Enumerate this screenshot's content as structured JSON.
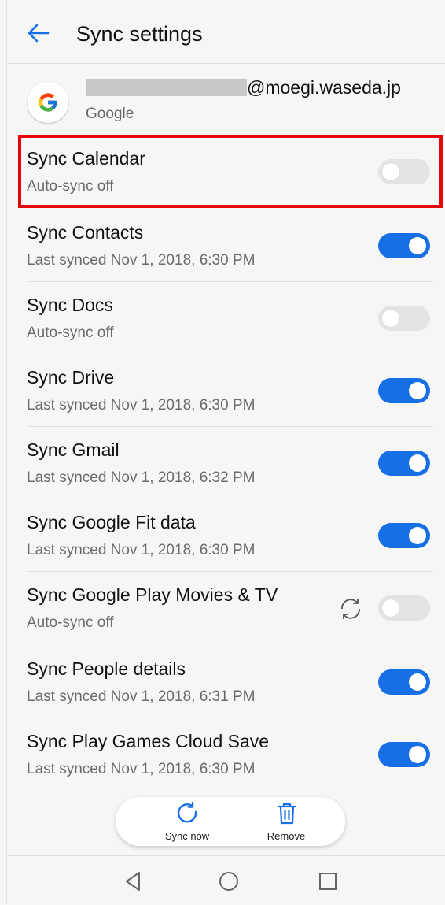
{
  "header": {
    "title": "Sync settings"
  },
  "account": {
    "email_suffix": "@moegi.waseda.jp",
    "type": "Google"
  },
  "items": [
    {
      "label": "Sync Calendar",
      "status": "Auto-sync off",
      "on": false
    },
    {
      "label": "Sync Contacts",
      "status": "Last synced Nov 1, 2018, 6:30 PM",
      "on": true
    },
    {
      "label": "Sync Docs",
      "status": "Auto-sync off",
      "on": false
    },
    {
      "label": "Sync Drive",
      "status": "Last synced Nov 1, 2018, 6:30 PM",
      "on": true
    },
    {
      "label": "Sync Gmail",
      "status": "Last synced Nov 1, 2018, 6:32 PM",
      "on": true
    },
    {
      "label": "Sync Google Fit data",
      "status": "Last synced Nov 1, 2018, 6:30 PM",
      "on": true
    },
    {
      "label": "Sync Google Play Movies & TV",
      "status": "Auto-sync off",
      "on": false
    },
    {
      "label": "Sync People details",
      "status": "Last synced Nov 1, 2018, 6:31 PM",
      "on": true
    },
    {
      "label": "Sync Play Games Cloud Save",
      "status": "Last synced Nov 1, 2018, 6:30 PM",
      "on": true
    }
  ],
  "actions": {
    "sync_now": "Sync now",
    "remove": "Remove"
  },
  "colors": {
    "accent": "#176fe6",
    "highlight": "#e8000a"
  },
  "icons": [
    "back-arrow-icon",
    "google-logo-icon",
    "sync-spinner-icon",
    "sync-now-icon",
    "trash-icon",
    "nav-back-icon",
    "nav-home-icon",
    "nav-recents-icon"
  ]
}
